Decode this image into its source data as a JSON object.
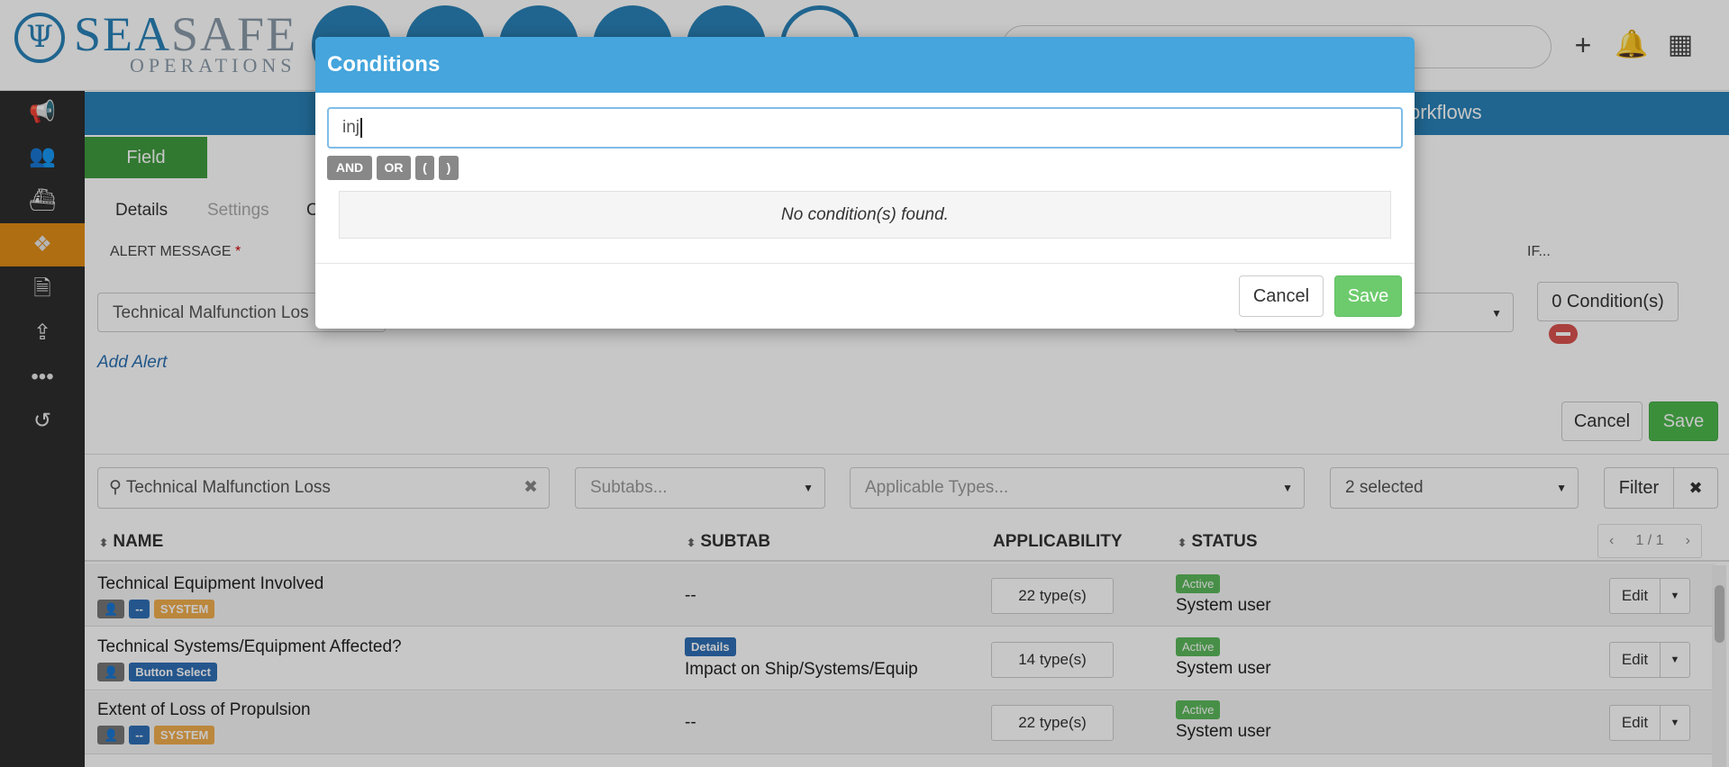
{
  "header": {
    "logo_sea": "SEA",
    "logo_safe": "SAFE",
    "logo_sub": "OPERATIONS",
    "icons": [
      "plus-icon",
      "bell-icon",
      "grid-icon"
    ]
  },
  "sidebar": {
    "items": [
      {
        "icon": "megaphone-icon"
      },
      {
        "icon": "users-icon"
      },
      {
        "icon": "ship-icon"
      },
      {
        "icon": "cubes-icon",
        "active": true
      },
      {
        "icon": "document-icon"
      },
      {
        "icon": "upload-icon"
      },
      {
        "icon": "ellipsis-icon"
      },
      {
        "icon": "history-icon"
      }
    ]
  },
  "main": {
    "bluebar_text": "orkflows",
    "field_tab": "Field",
    "subtabs": [
      "Details",
      "Settings",
      "C"
    ],
    "alert_message_label": "ALERT MESSAGE",
    "if_label": "IF...",
    "alert_message_value": "Technical Malfunction Los",
    "condition_count": "0 Condition(s)",
    "add_alert": "Add Alert",
    "cancel_label": "Cancel",
    "save_label": "Save"
  },
  "filters": {
    "search_value": "Technical Malfunction Loss",
    "subtabs_placeholder": "Subtabs...",
    "types_placeholder": "Applicable Types...",
    "status_selected": "2 selected",
    "filter_label": "Filter",
    "clear_label": "✖"
  },
  "table": {
    "headers": {
      "name": "NAME",
      "subtab": "SUBTAB",
      "applicability": "APPLICABILITY",
      "status": "STATUS"
    },
    "pagination": "1 / 1",
    "rows": [
      {
        "name": "Technical Equipment Involved",
        "badge_mid": "--",
        "badge_last": "SYSTEM",
        "subtab": "--",
        "subtab_badge": "",
        "types": "22 type(s)",
        "status": "Active",
        "status_user": "System user",
        "edit": "Edit"
      },
      {
        "name": "Technical Systems/Equipment Affected?",
        "badge_mid": "Button Select",
        "badge_last": "",
        "subtab": "Impact on Ship/Systems/Equip",
        "subtab_badge": "Details",
        "types": "14 type(s)",
        "status": "Active",
        "status_user": "System user",
        "edit": "Edit"
      },
      {
        "name": "Extent of Loss of Propulsion",
        "badge_mid": "--",
        "badge_last": "SYSTEM",
        "subtab": "--",
        "subtab_badge": "",
        "types": "22 type(s)",
        "status": "Active",
        "status_user": "System user",
        "edit": "Edit"
      }
    ]
  },
  "modal": {
    "title": "Conditions",
    "input_value": "inj",
    "operators": [
      "AND",
      "OR",
      "(",
      ")"
    ],
    "empty_message": "No condition(s) found.",
    "cancel_label": "Cancel",
    "save_label": "Save"
  },
  "colors": {
    "brand_blue": "#2a82b8",
    "modal_header": "#45a5dc",
    "green": "#4cb84c",
    "active_orange": "#e08e16"
  }
}
